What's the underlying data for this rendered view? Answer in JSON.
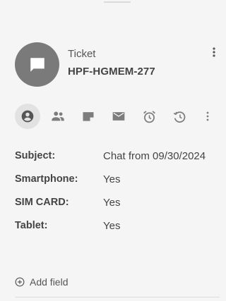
{
  "ticket": {
    "type_label": "Ticket",
    "id": "HPF-HGMEM-277"
  },
  "icons": {
    "avatar": "chat-bubble-icon",
    "menu": "more-vert-icon",
    "tabs": [
      "account-circle-icon",
      "people-icon",
      "note-icon",
      "mail-icon",
      "alarm-icon",
      "history-icon",
      "more-vert-icon"
    ]
  },
  "fields": [
    {
      "label": "Subject:",
      "value": "Chat from 09/30/2024"
    },
    {
      "label": "Smartphone:",
      "value": "Yes"
    },
    {
      "label": "SIM CARD:",
      "value": "Yes"
    },
    {
      "label": "Tablet:",
      "value": "Yes"
    }
  ],
  "add_field_label": "Add field",
  "colors": {
    "background": "#f5f5f5",
    "avatar": "#7a7a7a",
    "icon": "#7d7d7d",
    "active_tab": "#e2e2e2"
  }
}
